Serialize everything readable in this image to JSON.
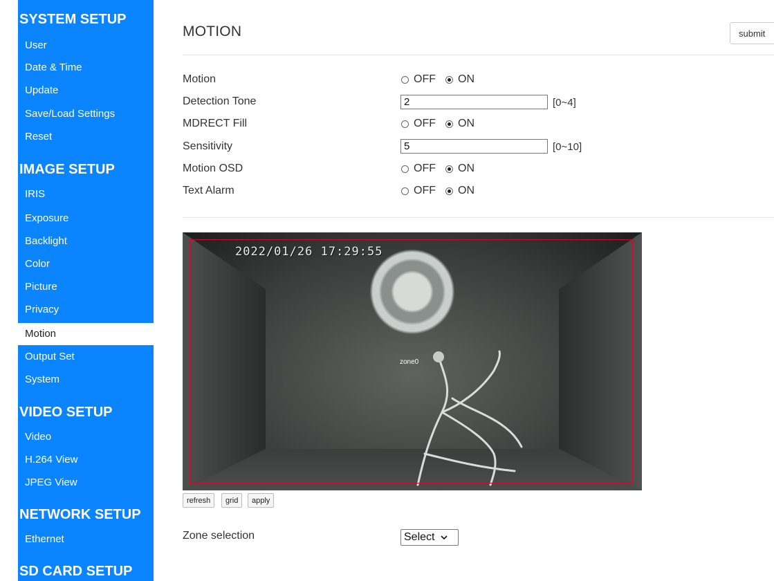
{
  "sidebar": {
    "sections": [
      {
        "title": "SYSTEM SETUP",
        "items": [
          "User",
          "Date & Time",
          "Update",
          "Save/Load Settings",
          "Reset"
        ]
      },
      {
        "title": "IMAGE SETUP",
        "items": [
          "IRIS",
          "Exposure",
          "Backlight",
          "Color",
          "Picture",
          "Privacy",
          "Motion",
          "Output Set",
          "System"
        ]
      },
      {
        "title": "VIDEO SETUP",
        "items": [
          "Video",
          "H.264 View",
          "JPEG View"
        ]
      },
      {
        "title": "NETWORK SETUP",
        "items": [
          "Ethernet"
        ]
      },
      {
        "title": "SD CARD SETUP",
        "items": []
      }
    ],
    "active_item": "Motion"
  },
  "page": {
    "title": "MOTION",
    "submit_label": "submit"
  },
  "settings": {
    "motion": {
      "label": "Motion",
      "off": "OFF",
      "on": "ON",
      "value": "ON"
    },
    "detection_tone": {
      "label": "Detection Tone",
      "value": "2",
      "range": "[0~4]"
    },
    "mdrect_fill": {
      "label": "MDRECT Fill",
      "off": "OFF",
      "on": "ON",
      "value": "ON"
    },
    "sensitivity": {
      "label": "Sensitivity",
      "value": "5",
      "range": "[0~10]"
    },
    "motion_osd": {
      "label": "Motion OSD",
      "off": "OFF",
      "on": "ON",
      "value": "ON"
    },
    "text_alarm": {
      "label": "Text Alarm",
      "off": "OFF",
      "on": "ON",
      "value": "ON"
    }
  },
  "camera": {
    "timestamp": "2022/01/26 17:29:55",
    "zone_label": "zone0",
    "zone_color": "#c8102e"
  },
  "camera_buttons": {
    "refresh": "refresh",
    "grid": "grid",
    "apply": "apply"
  },
  "zone": {
    "label": "Zone selection",
    "selected": "Select"
  },
  "colors": {
    "sidebar_bg": "#0a84ff",
    "active_bg": "#ffffff"
  }
}
